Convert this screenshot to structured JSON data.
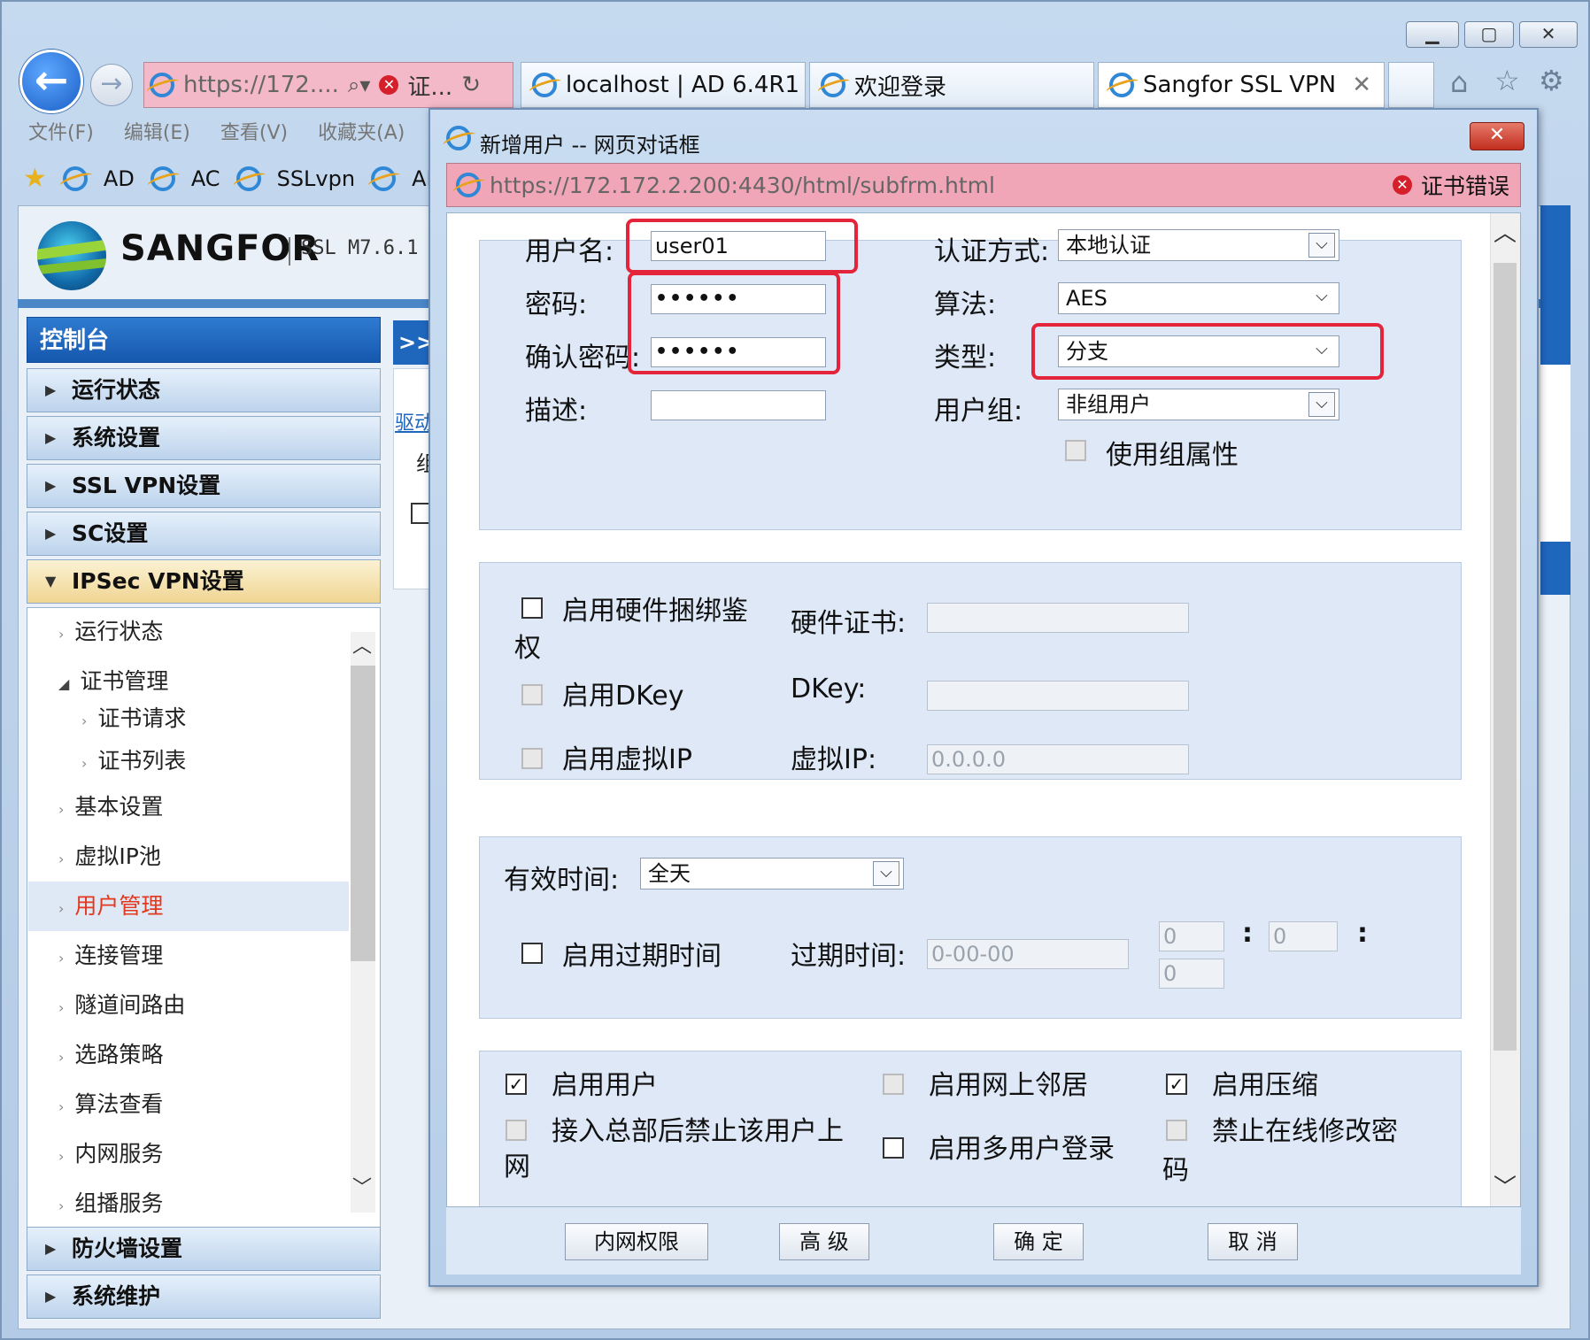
{
  "browser": {
    "address_url": "https://172....",
    "address_cert": "证...",
    "tabs": [
      {
        "label": "localhost | AD 6.4R1"
      },
      {
        "label": "欢迎登录"
      },
      {
        "label": "Sangfor SSL VPN"
      }
    ],
    "menu": [
      "文件(F)",
      "编辑(E)",
      "查看(V)",
      "收藏夹(A)"
    ],
    "favorites": [
      "AD",
      "AC",
      "SSLvpn",
      "AF"
    ]
  },
  "app": {
    "brand": "SANGFOR",
    "version": "SSL M7.6.1"
  },
  "sidebar": {
    "header": "控制台",
    "sections": [
      {
        "label": "运行状态"
      },
      {
        "label": "系统设置"
      },
      {
        "label": "SSL VPN设置"
      },
      {
        "label": "SC设置"
      },
      {
        "label": "IPSec VPN设置"
      },
      {
        "label": "防火墙设置"
      },
      {
        "label": "系统维护"
      }
    ],
    "subitems": [
      {
        "label": "运行状态"
      },
      {
        "label": "证书管理"
      },
      {
        "label": "证书请求"
      },
      {
        "label": "证书列表"
      },
      {
        "label": "基本设置"
      },
      {
        "label": "虚拟IP池"
      },
      {
        "label": "用户管理"
      },
      {
        "label": "连接管理"
      },
      {
        "label": "隧道间路由"
      },
      {
        "label": "选路策略"
      },
      {
        "label": "算法查看"
      },
      {
        "label": "内网服务"
      },
      {
        "label": "组播服务"
      }
    ],
    "colors": {
      "active_item": "#e3371e",
      "header_blue": "#1f66bd"
    }
  },
  "background": {
    "toggle": ">>",
    "text1": "驱动",
    "text2": "组"
  },
  "dialog": {
    "title": "新增用户 -- 网页对话框",
    "url": "https://172.172.2.200:4430/html/subfrm.html",
    "cert_error": "证书错误",
    "close_label": "✕",
    "basic": {
      "username_label": "用户名:",
      "username_value": "user01",
      "password_label": "密码:",
      "password_value": "••••••",
      "confirm_label": "确认密码:",
      "confirm_value": "••••••",
      "desc_label": "描述:",
      "desc_value": "",
      "auth_label": "认证方式:",
      "auth_value": "本地认证",
      "algo_label": "算法:",
      "algo_value": "AES",
      "type_label": "类型:",
      "type_value": "分支",
      "group_label": "用户组:",
      "group_value": "非组用户",
      "use_group_label": "使用组属性"
    },
    "hardware": {
      "hw_bind_label": "启用硬件捆绑鉴",
      "hw_bind_label2": "权",
      "hw_cert_label": "硬件证书:",
      "hw_cert_value": "",
      "dkey_enable_label": "启用DKey",
      "dkey_label": "DKey:",
      "dkey_value": "",
      "vip_enable_label": "启用虚拟IP",
      "vip_label": "虚拟IP:",
      "vip_value": "0.0.0.0"
    },
    "time": {
      "valid_label": "有效时间:",
      "valid_value": "全天",
      "expire_enable_label": "启用过期时间",
      "expire_label": "过期时间:",
      "expire_date": "0-00-00",
      "hour": "0",
      "minute": "0",
      "second": "0",
      "colon": ":"
    },
    "options": {
      "enable_user": "启用用户",
      "enable_neighbor": "启用网上邻居",
      "enable_compress": "启用压缩",
      "deny_after_hq": "接入总部后禁止该用户上",
      "deny_after_hq2": "网",
      "multi_login": "启用多用户登录",
      "deny_pwd_change": "禁止在线修改密",
      "deny_pwd_change2": "码"
    },
    "buttons": {
      "intranet": "内网权限",
      "advanced": "高 级",
      "ok": "确 定",
      "cancel": "取 消"
    },
    "highlight_color": "#e3243b"
  }
}
